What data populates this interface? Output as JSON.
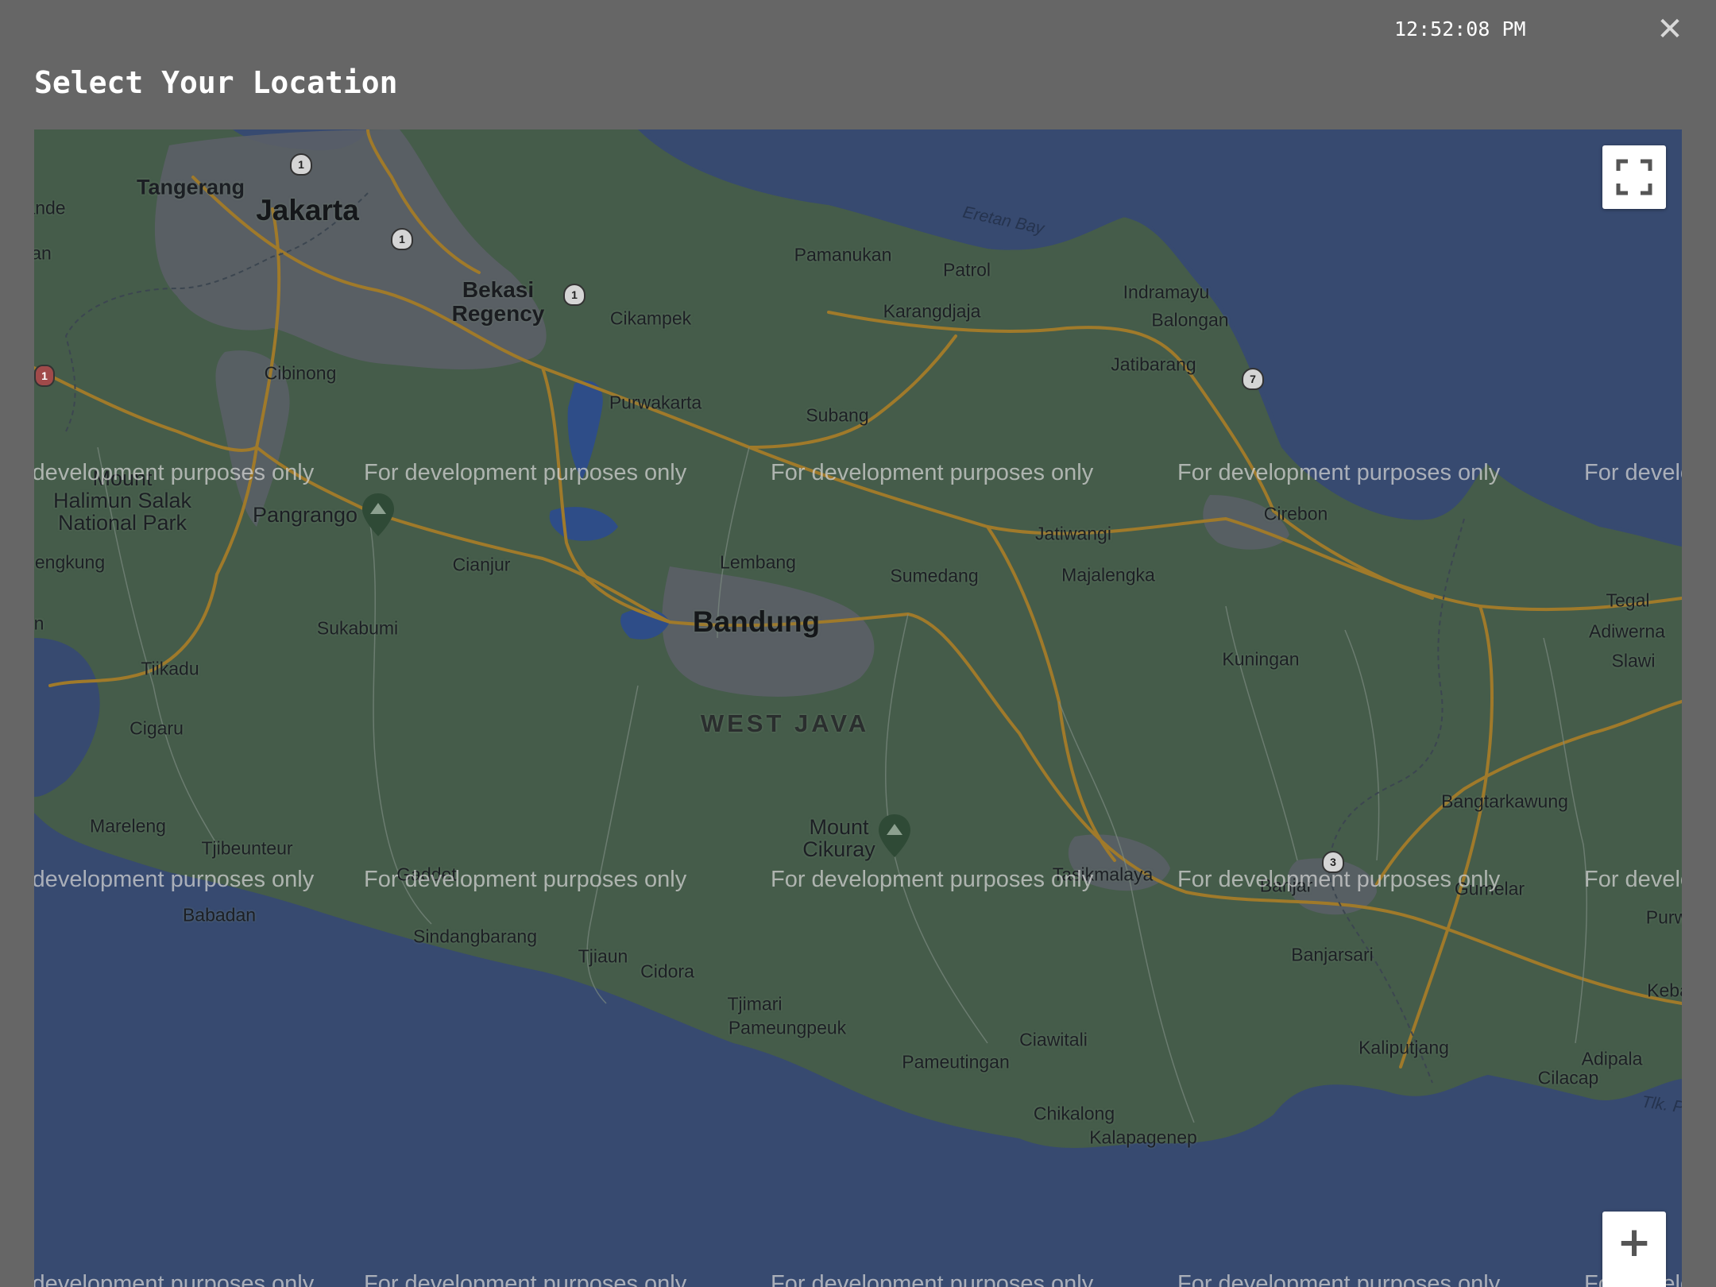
{
  "header": {
    "clock": "12:52:08 PM",
    "close_icon": "close-icon",
    "title": "Select Your Location"
  },
  "map": {
    "watermark": "For development purposes only",
    "controls": {
      "fullscreen_icon": "fullscreen-icon",
      "zoom_in_label": "+"
    },
    "colors": {
      "water": "#374a70",
      "land": "#455c4a",
      "urban": "#5b5f67",
      "road": "#a07a2a"
    },
    "labels": {
      "jakarta": "Jakarta",
      "tangerang": "Tangerang",
      "bekasi": "Bekasi\nRegency",
      "cibinong": "Cibinong",
      "cikampek": "Cikampek",
      "pamanukan": "Pamanukan",
      "patrol": "Patrol",
      "karangdjaja": "Karangdjaja",
      "indramayu": "Indramayu",
      "balongan": "Balongan",
      "jatibarang": "Jatibarang",
      "purwakarta": "Purwakarta",
      "subang": "Subang",
      "halimun": "Mount\nHalimun Salak\nNational Park",
      "pangrango": "Pangrango",
      "cianjur": "Cianjur",
      "lembang": "Lembang",
      "sumedang": "Sumedang",
      "jatiwangi": "Jatiwangi",
      "majalengka": "Majalengka",
      "cirebon": "Cirebon",
      "bandung": "Bandung",
      "sukabumi": "Sukabumi",
      "kuningan": "Kuningan",
      "tegal": "Tegal",
      "adiwerna": "Adiwerna",
      "slawi": "Slawi",
      "tiikadu": "Tiikadu",
      "west_java": "WEST JAVA",
      "cigaru": "Cigaru",
      "engkung": "engkung",
      "bangtarkawung": "Bangtarkawung",
      "mareleng": "Mareleng",
      "tjibeunteur": "Tjibeunteur",
      "mount_cikuray": "Mount\nCikuray",
      "gaddet": "Gaddet",
      "tasikmalaya": "Tasikmalaya",
      "banjar": "Banjar",
      "gumelar": "Gumelar",
      "babadan": "Babadan",
      "sindangbarang": "Sindangbarang",
      "tjiaun": "Tjiaun",
      "cidora": "Cidora",
      "banjarsari": "Banjarsari",
      "purw": "Purw",
      "tjimari": "Tjimari",
      "pameungpeuk": "Pameungpeuk",
      "ciawitali": "Ciawitali",
      "kaliputjang": "Kaliputjang",
      "keba": "Keba",
      "adipala": "Adipala",
      "pameutingan": "Pameutingan",
      "cilacap": "Cilacap",
      "chikalong": "Chikalong",
      "kalapagenep": "Kalapagenep",
      "eretan_bay": "Eretan Bay",
      "tlk": "Tlk. P",
      "ande": "ande",
      "an": "an",
      "n": "n"
    },
    "route_shields": [
      "1",
      "1",
      "1",
      "7",
      "3",
      "1"
    ]
  }
}
